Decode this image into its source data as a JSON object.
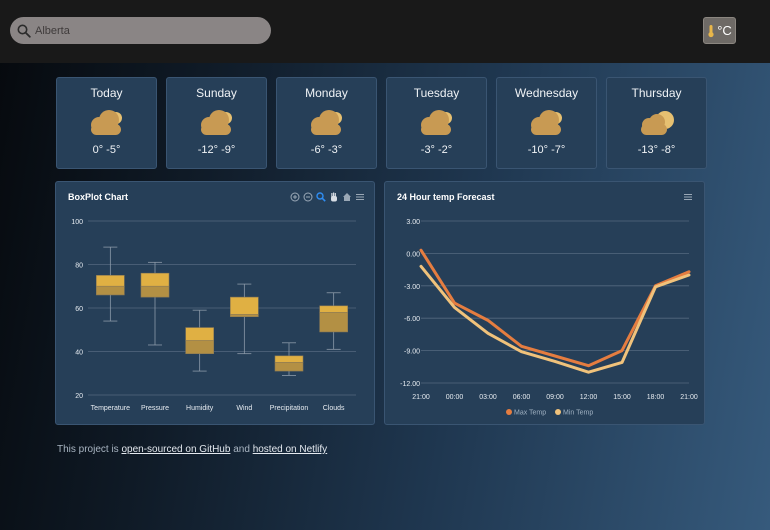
{
  "search": {
    "placeholder": "Alberta"
  },
  "unit_toggle": {
    "label": "°C"
  },
  "forecast_days": [
    {
      "name": "Today",
      "temp": "0° -5°",
      "icon": "cloud-icon"
    },
    {
      "name": "Sunday",
      "temp": "-12° -9°",
      "icon": "cloud-icon"
    },
    {
      "name": "Monday",
      "temp": "-6° -3°",
      "icon": "cloud-icon"
    },
    {
      "name": "Tuesday",
      "temp": "-3° -2°",
      "icon": "cloud-icon"
    },
    {
      "name": "Wednesday",
      "temp": "-10° -7°",
      "icon": "cloud-icon"
    },
    {
      "name": "Thursday",
      "temp": "-13° -8°",
      "icon": "partly-cloudy-icon"
    }
  ],
  "boxplot_panel": {
    "title": "BoxPlot Chart",
    "toolbar": [
      "zoom-in-icon",
      "zoom-out-icon",
      "zoom-select-icon",
      "pan-icon",
      "home-icon",
      "menu-icon"
    ]
  },
  "temp_panel": {
    "title": "24 Hour temp Forecast",
    "toolbar": [
      "menu-icon"
    ]
  },
  "footer": {
    "prefix": "This project is ",
    "link1": "open-sourced on GitHub",
    "middle": " and ",
    "link2": "hosted on Netlify"
  },
  "colors": {
    "box_upper": "#e0b043",
    "box_lower": "#b39044",
    "max_temp": "#e57d40",
    "min_temp": "#f0c27b",
    "card_bg": "#263f58"
  },
  "chart_data": [
    {
      "type": "boxplot",
      "title": "BoxPlot Chart",
      "categories": [
        "Temperature",
        "Pressure",
        "Humidity",
        "Wind",
        "Precipitation",
        "Clouds"
      ],
      "boxes": [
        {
          "min": 54,
          "q1": 66,
          "median": 70,
          "q3": 75,
          "max": 88
        },
        {
          "min": 43,
          "q1": 65,
          "median": 70,
          "q3": 76,
          "max": 81
        },
        {
          "min": 31,
          "q1": 39,
          "median": 45,
          "q3": 51,
          "max": 59
        },
        {
          "min": 39,
          "q1": 56,
          "median": 57,
          "q3": 65,
          "max": 71
        },
        {
          "min": 29,
          "q1": 31,
          "median": 35,
          "q3": 38,
          "max": 44
        },
        {
          "min": 41,
          "q1": 49,
          "median": 58,
          "q3": 61,
          "max": 67
        }
      ],
      "yticks": [
        "20",
        "40",
        "60",
        "80",
        "100"
      ],
      "ylim": [
        20,
        100
      ]
    },
    {
      "type": "line",
      "title": "24 Hour temp Forecast",
      "x": [
        "21:00",
        "00:00",
        "03:00",
        "06:00",
        "09:00",
        "12:00",
        "15:00",
        "18:00",
        "21:00"
      ],
      "yticks": [
        "3.00",
        "0.00",
        "-3.00",
        "-6.00",
        "-9.00",
        "-12.00"
      ],
      "ylim": [
        -12,
        3
      ],
      "series": [
        {
          "name": "Max Temp",
          "values": [
            0.3,
            -4.6,
            -6.2,
            -8.6,
            -9.5,
            -10.4,
            -9.0,
            -3.0,
            -1.7
          ]
        },
        {
          "name": "Min Temp",
          "values": [
            -1.2,
            -5.0,
            -7.4,
            -9.1,
            -10.0,
            -11.0,
            -10.1,
            -3.1,
            -2.0
          ]
        }
      ]
    }
  ]
}
